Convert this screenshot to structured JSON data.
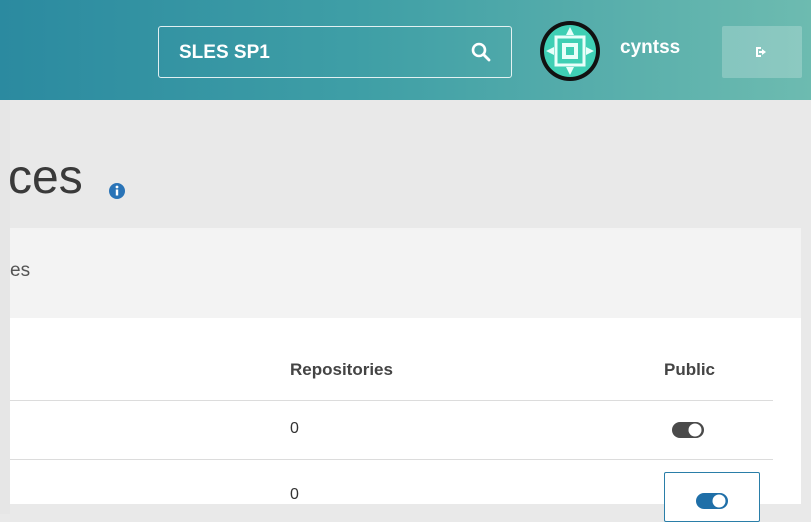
{
  "header": {
    "search_value": "SLES SP1",
    "username": "cyntss",
    "search_icon": "search-icon",
    "logout_icon": "logout-icon"
  },
  "page": {
    "title_fragment": "ces",
    "info_icon": "info-icon",
    "panel_text_fragment": "es"
  },
  "table": {
    "columns": [
      "Repositories",
      "Public"
    ],
    "rows": [
      {
        "repositories": "0",
        "public": true
      },
      {
        "repositories": "0",
        "public": true
      }
    ]
  },
  "colors": {
    "header_start": "#2b8aa0",
    "header_end": "#6dbbb0",
    "accent": "#2a7ea8",
    "toggle_off": "#4a4a4a"
  }
}
